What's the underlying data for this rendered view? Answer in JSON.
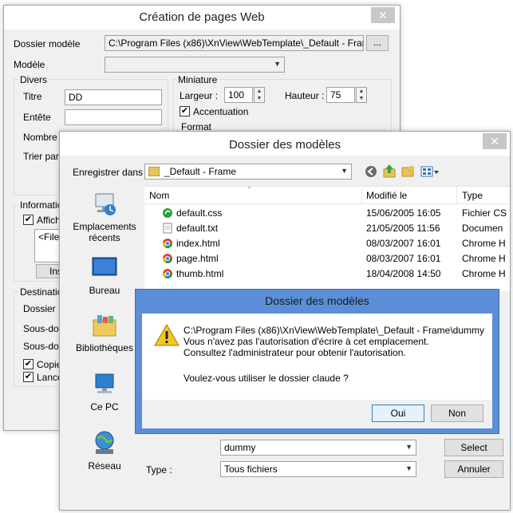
{
  "web_window": {
    "title": "Création de pages Web",
    "close_glyph": "✕",
    "template_folder_label": "Dossier modèle",
    "template_folder_value": "C:\\Program Files (x86)\\XnView\\WebTemplate\\_Default - Frame\\",
    "browse_label": "...",
    "model_label": "Modèle",
    "divers_label": "Divers",
    "titre_label": "Titre",
    "titre_value": "DD",
    "entete_label": "Entête",
    "nombre_label": "Nombre c",
    "trier_label": "Trier par",
    "miniature_label": "Miniature",
    "largeur_label": "Largeur :",
    "largeur_value": "100",
    "hauteur_label": "Hauteur :",
    "hauteur_value": "75",
    "accentuation_label": "Accentuation",
    "format_label": "Format",
    "information_label": "Informatio",
    "affich_label": "Affich",
    "filen_text": "<Filen",
    "ins_label": "Ins",
    "destination_label": "Destinatio",
    "dossier_label": "Dossier",
    "sousdos1_label": "Sous-dos",
    "sousdos2_label": "Sous-dos",
    "copier_label": "Copier",
    "lance_label": "Lance"
  },
  "folder_dialog": {
    "title": "Dossier des modèles",
    "close_glyph": "✕",
    "save_in_label": "Enregistrer dans :",
    "save_in_value": "_Default - Frame",
    "places": [
      {
        "label": "Emplacements récents",
        "icon": "recent-places-icon"
      },
      {
        "label": "Bureau",
        "icon": "desktop-icon"
      },
      {
        "label": "Bibliothèques",
        "icon": "libraries-icon"
      },
      {
        "label": "Ce PC",
        "icon": "computer-icon"
      },
      {
        "label": "Réseau",
        "icon": "network-icon"
      }
    ],
    "columns": {
      "name": "Nom",
      "modified": "Modifié le",
      "type": "Type"
    },
    "files": [
      {
        "name": "default.css",
        "modified": "15/06/2005 16:05",
        "type": "Fichier CS",
        "icon": "css-file-icon"
      },
      {
        "name": "default.txt",
        "modified": "21/05/2005 11:56",
        "type": "Documen",
        "icon": "text-file-icon"
      },
      {
        "name": "index.html",
        "modified": "08/03/2007 16:01",
        "type": "Chrome H",
        "icon": "chrome-html-icon"
      },
      {
        "name": "page.html",
        "modified": "08/03/2007 16:01",
        "type": "Chrome H",
        "icon": "chrome-html-icon"
      },
      {
        "name": "thumb.html",
        "modified": "18/04/2008 14:50",
        "type": "Chrome H",
        "icon": "chrome-html-icon"
      }
    ],
    "filename_value": "dummy",
    "select_label": "Select",
    "type_label": "Type :",
    "type_value": "Tous fichiers",
    "cancel_label": "Annuler"
  },
  "alert_dialog": {
    "title": "Dossier des modèles",
    "line1": "C:\\Program Files (x86)\\XnView\\WebTemplate\\_Default - Frame\\dummy",
    "line2": "Vous n'avez pas l'autorisation d'écrire à cet emplacement.",
    "line3": "Consultez l'administrateur pour obtenir l'autorisation.",
    "question": "Voulez-vous utiliser le dossier claude ?",
    "yes_label": "Oui",
    "no_label": "Non",
    "accent_color": "#5b8ed6"
  }
}
